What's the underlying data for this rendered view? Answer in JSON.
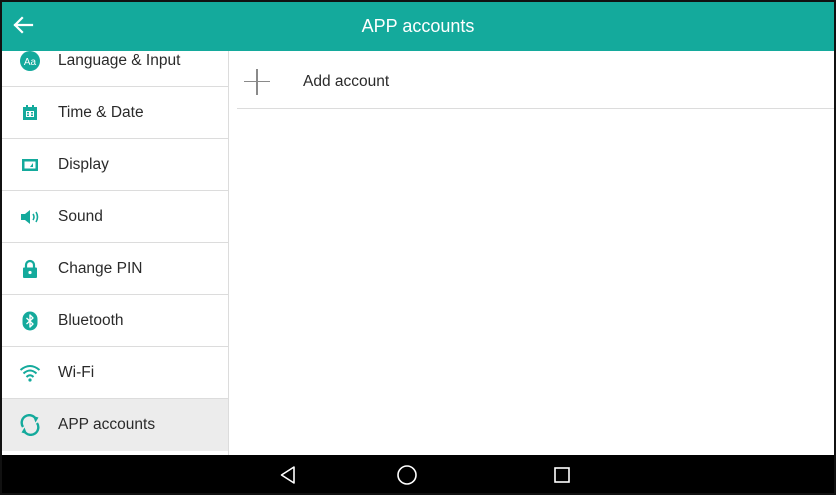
{
  "header": {
    "title": "APP accounts",
    "back_icon": "arrow-left-icon",
    "background": "#14aa9c"
  },
  "sidebar": {
    "items": [
      {
        "label": "Language & Input",
        "icon": "language-icon"
      },
      {
        "label": "Time & Date",
        "icon": "calendar-icon"
      },
      {
        "label": "Display",
        "icon": "display-icon"
      },
      {
        "label": "Sound",
        "icon": "speaker-icon"
      },
      {
        "label": "Change PIN",
        "icon": "lock-icon"
      },
      {
        "label": "Bluetooth",
        "icon": "bluetooth-icon"
      },
      {
        "label": "Wi-Fi",
        "icon": "wifi-icon"
      },
      {
        "label": "APP accounts",
        "icon": "sync-icon",
        "selected": true
      }
    ],
    "icon_color": "#14aa9c"
  },
  "content": {
    "add_account_label": "Add account",
    "add_icon": "plus-icon"
  },
  "navbar": {
    "buttons": [
      "back-triangle-icon",
      "home-circle-icon",
      "recents-square-icon"
    ]
  }
}
